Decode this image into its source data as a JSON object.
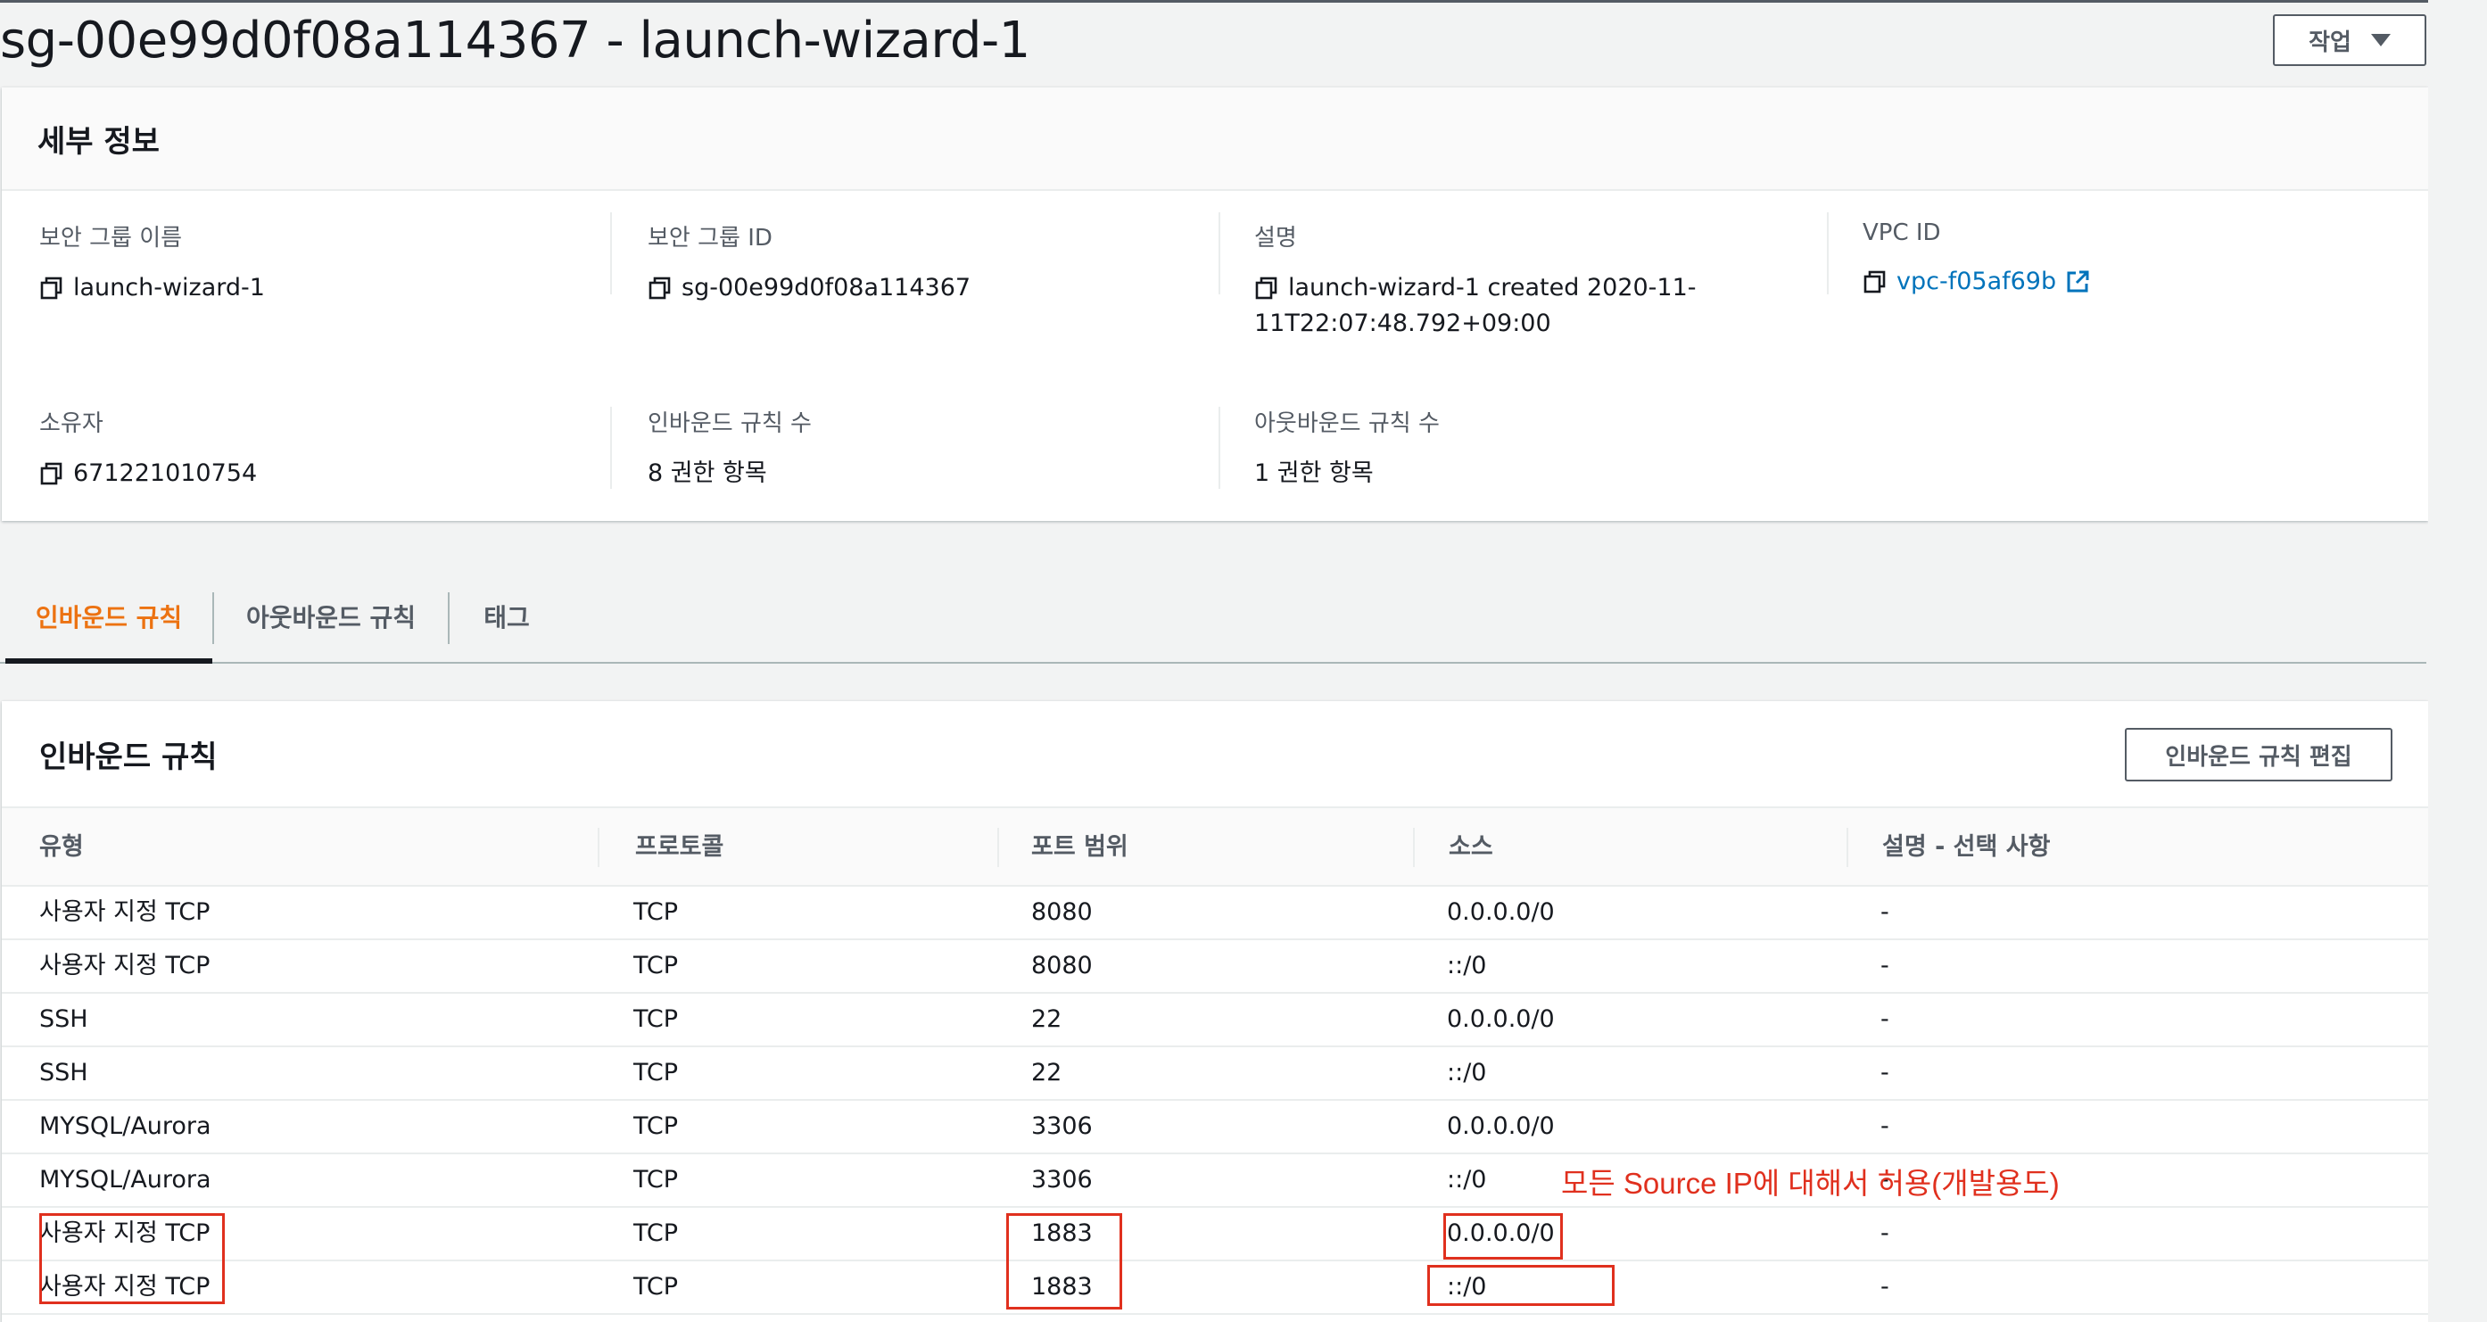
{
  "page": {
    "title": "sg-00e99d0f08a114367 - launch-wizard-1",
    "actions_label": "작업"
  },
  "details": {
    "header": "세부 정보",
    "fields": [
      {
        "label": "보안 그룹 이름",
        "value": "launch-wizard-1",
        "icon": "copy-icon"
      },
      {
        "label": "보안 그룹 ID",
        "value": "sg-00e99d0f08a114367",
        "icon": "copy-icon"
      },
      {
        "label": "설명",
        "value": "launch-wizard-1 created 2020-11-11T22:07:48.792+09:00",
        "icon": "copy-icon"
      },
      {
        "label": "VPC ID",
        "value": "vpc-f05af69b",
        "icon": "copy-icon",
        "link_icon": "external-link-icon"
      },
      {
        "label": "소유자",
        "value": "671221010754",
        "icon": "copy-icon"
      },
      {
        "label": "인바운드 규칙 수",
        "value": "8 권한 항목"
      },
      {
        "label": "아웃바운드 규칙 수",
        "value": "1 권한 항목"
      }
    ],
    "description_line1": "launch-wizard-1 created 2020-11-",
    "description_line2": "11T22:07:48.792+09:00"
  },
  "tabs": [
    {
      "label": "인바운드 규칙",
      "active": true
    },
    {
      "label": "아웃바운드 규칙",
      "active": false
    },
    {
      "label": "태그",
      "active": false
    }
  ],
  "inbound": {
    "title": "인바운드 규칙",
    "edit_label": "인바운드 규칙 편집",
    "columns": [
      "유형",
      "프로토콜",
      "포트 범위",
      "소스",
      "설명 - 선택 사항"
    ],
    "rows": [
      [
        "사용자 지정 TCP",
        "TCP",
        "8080",
        "0.0.0.0/0",
        "-"
      ],
      [
        "사용자 지정 TCP",
        "TCP",
        "8080",
        "::/0",
        "-"
      ],
      [
        "SSH",
        "TCP",
        "22",
        "0.0.0.0/0",
        "-"
      ],
      [
        "SSH",
        "TCP",
        "22",
        "::/0",
        "-"
      ],
      [
        "MYSQL/Aurora",
        "TCP",
        "3306",
        "0.0.0.0/0",
        "-"
      ],
      [
        "MYSQL/Aurora",
        "TCP",
        "3306",
        "::/0",
        "-"
      ],
      [
        "사용자 지정 TCP",
        "TCP",
        "1883",
        "0.0.0.0/0",
        "-"
      ],
      [
        "사용자 지정 TCP",
        "TCP",
        "1883",
        "::/0",
        "-"
      ]
    ]
  },
  "annotation": "모든 Source IP에 대해서 허용(개발용도)",
  "colors": {
    "accent": "#ec7211",
    "link": "#0073bb",
    "annotation": "#e0301e"
  }
}
